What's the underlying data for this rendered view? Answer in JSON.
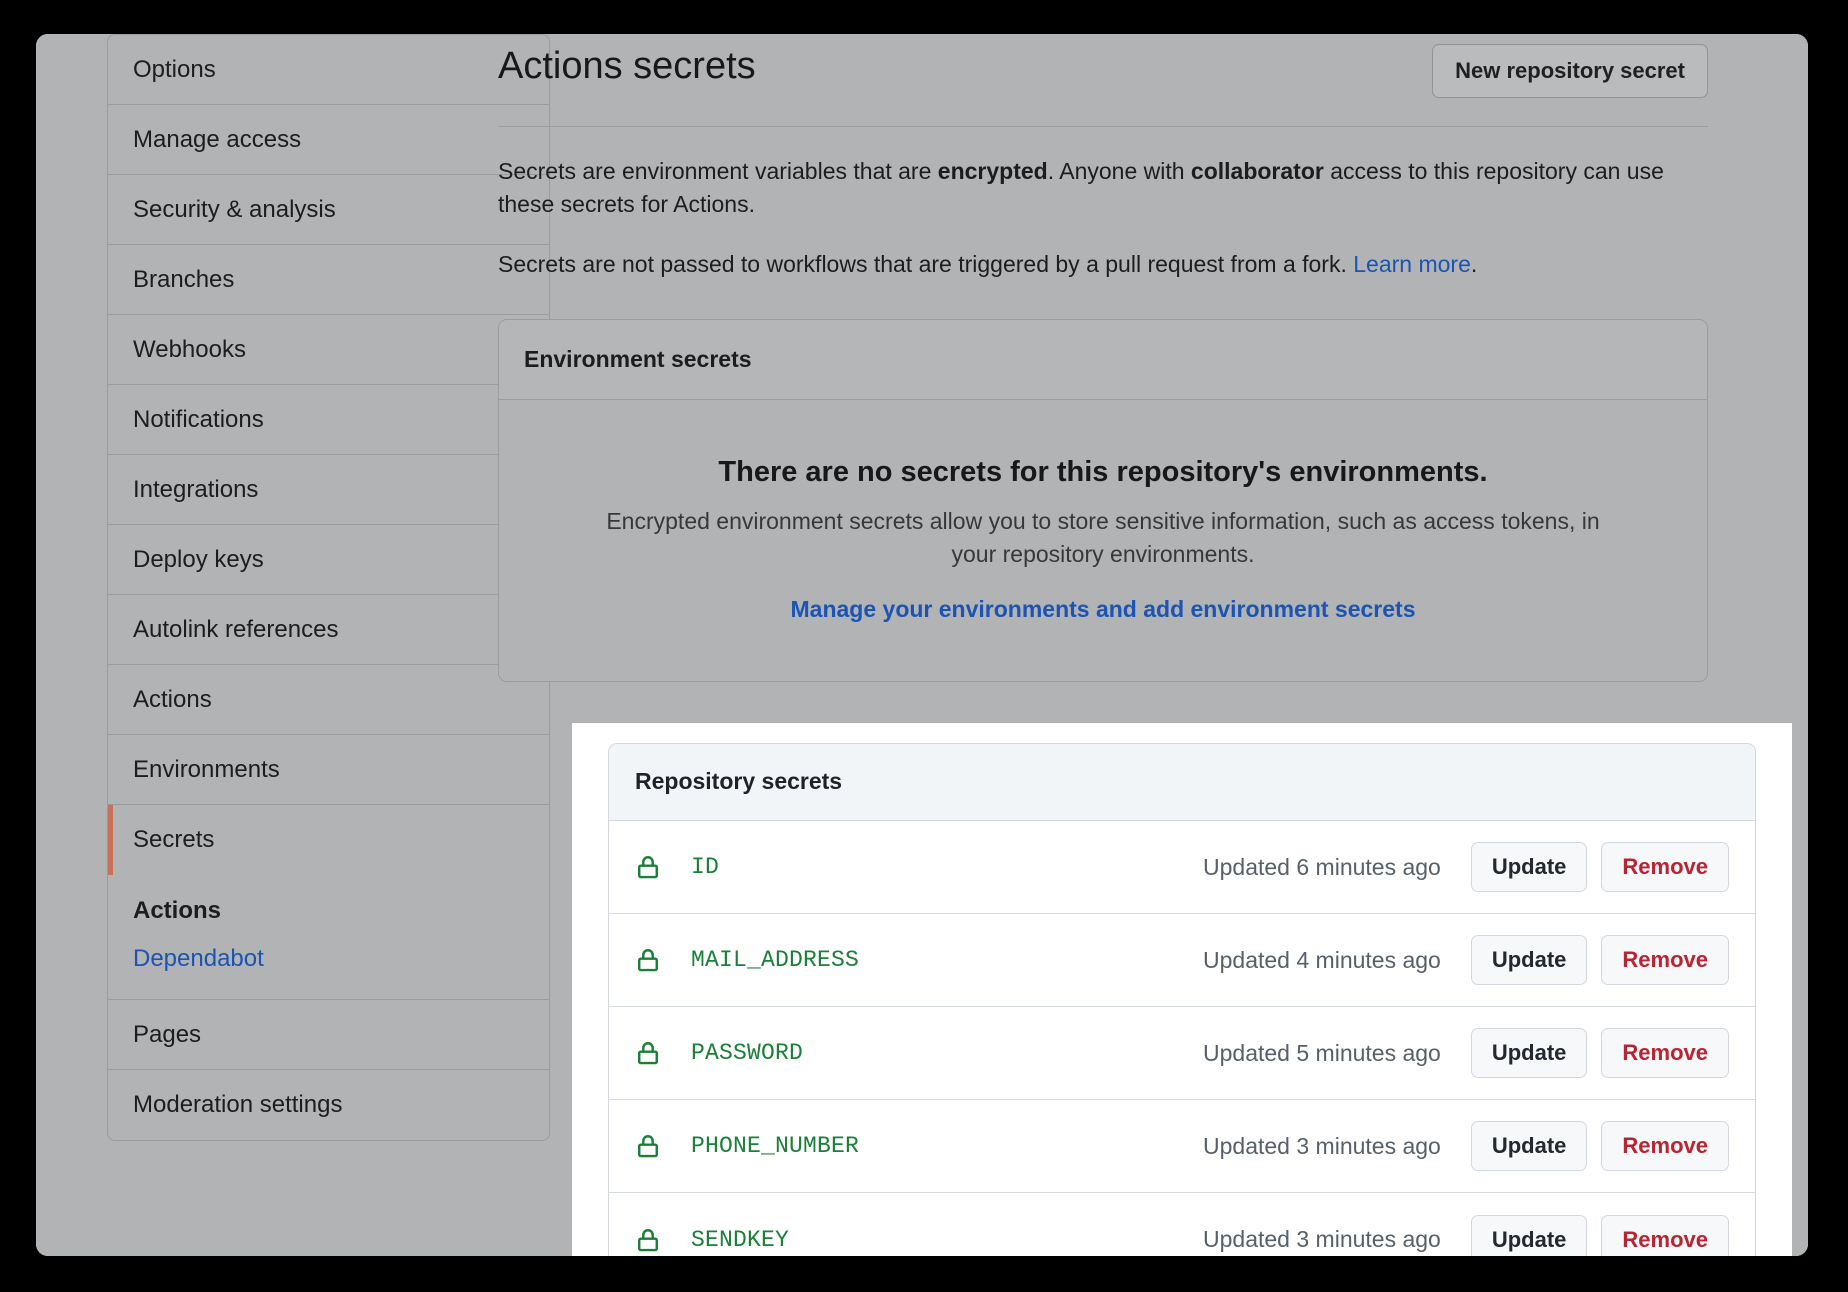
{
  "sidebar": {
    "items": [
      {
        "label": "Options",
        "selected": false
      },
      {
        "label": "Manage access",
        "selected": false
      },
      {
        "label": "Security & analysis",
        "selected": false
      },
      {
        "label": "Branches",
        "selected": false
      },
      {
        "label": "Webhooks",
        "selected": false
      },
      {
        "label": "Notifications",
        "selected": false
      },
      {
        "label": "Integrations",
        "selected": false
      },
      {
        "label": "Deploy keys",
        "selected": false
      },
      {
        "label": "Autolink references",
        "selected": false
      },
      {
        "label": "Actions",
        "selected": false
      },
      {
        "label": "Environments",
        "selected": false
      },
      {
        "label": "Secrets",
        "selected": true
      }
    ],
    "secrets_group": {
      "title": "Actions",
      "link": "Dependabot"
    },
    "items_after": [
      {
        "label": "Pages",
        "selected": false
      },
      {
        "label": "Moderation settings",
        "selected": false
      }
    ],
    "selected_accent": "#c9705a"
  },
  "main": {
    "title": "Actions secrets",
    "new_secret_button": "New repository secret",
    "intro": {
      "part1": "Secrets are environment variables that are ",
      "bold1": "encrypted",
      "part2": ". Anyone with ",
      "bold2": "collaborator",
      "part3": " access to this repository can use these secrets for Actions."
    },
    "fork_note": {
      "text": "Secrets are not passed to workflows that are triggered by a pull request from a fork. ",
      "link": "Learn more",
      "suffix": "."
    },
    "environment_secrets": {
      "header": "Environment secrets",
      "empty_title": "There are no secrets for this repository's environments.",
      "empty_desc": "Encrypted environment secrets allow you to store sensitive information, such as access tokens, in your repository environments.",
      "manage_link": "Manage your environments and add environment secrets"
    },
    "repository_secrets": {
      "header": "Repository secrets",
      "update_label": "Update",
      "remove_label": "Remove",
      "rows": [
        {
          "name": "ID",
          "updated": "Updated 6 minutes ago"
        },
        {
          "name": "MAIL_ADDRESS",
          "updated": "Updated 4 minutes ago"
        },
        {
          "name": "PASSWORD",
          "updated": "Updated 5 minutes ago"
        },
        {
          "name": "PHONE_NUMBER",
          "updated": "Updated 3 minutes ago"
        },
        {
          "name": "SENDKEY",
          "updated": "Updated 3 minutes ago"
        }
      ]
    }
  },
  "colors": {
    "link": "#1b54b5",
    "secret_green": "#1a7f37",
    "remove_red": "#ba2331",
    "dim_overlay": "#b1b3b4"
  },
  "icons": {
    "lock": "lock-icon"
  }
}
